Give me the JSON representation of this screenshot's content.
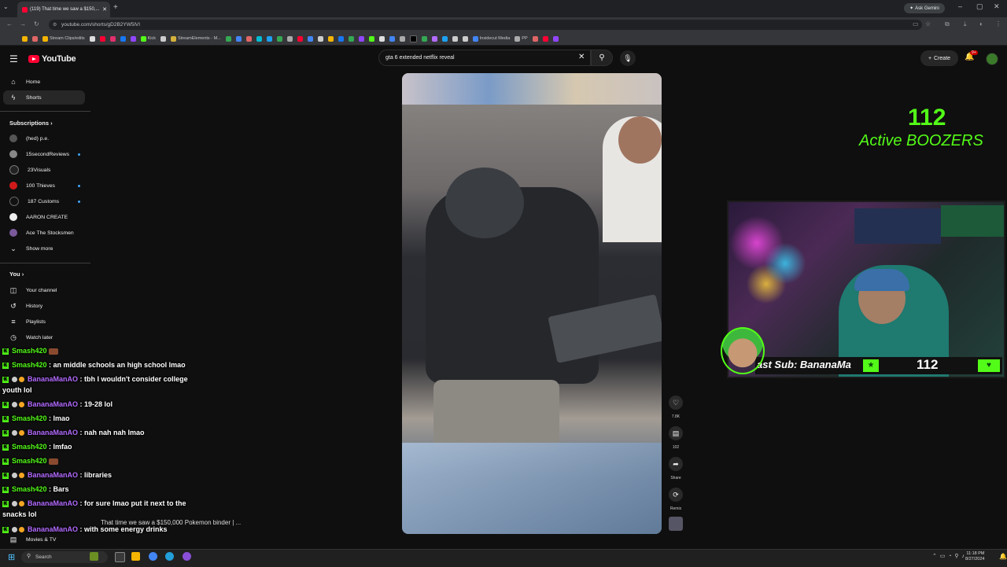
{
  "browser": {
    "tab_title": "(119) That time we saw a $150,...",
    "url": "youtube.com/shorts/gD2B2YW5lVI",
    "ask_gemini": "Ask Gemini",
    "bookmarks": [
      "Stream Clips/edits",
      "Kick",
      "StreamElements - M...",
      "Insidecut Media",
      "PP"
    ]
  },
  "youtube": {
    "logo": "YouTube",
    "search_value": "gta 6 extended netflix reveal",
    "create_label": "Create",
    "notif_badge": "9+",
    "sidebar": {
      "home": "Home",
      "shorts": "Shorts",
      "subscriptions_heading": "Subscriptions",
      "subscriptions": [
        "(hed) p.e.",
        "15secondReviews",
        "23Visuals",
        "100 Thieves",
        "187 Customs",
        "AARON CREATE",
        "Ace The Stocksmen"
      ],
      "show_more": "Show more",
      "you_heading": "You",
      "you_items": [
        "Your channel",
        "History",
        "Playlists",
        "Watch later"
      ],
      "bottom_item": "Movies & TV"
    },
    "video_title": "That time we saw a $150,000 Pokemon binder | ...",
    "actions": {
      "likes": "7.8K",
      "comments": "102",
      "share": "Share",
      "remix": "Remix"
    }
  },
  "stream": {
    "viewers_number": "112",
    "viewers_label": "Active BOOZERS",
    "last_sub_text": "ast Sub: BananaMa",
    "sub_counter": "112"
  },
  "chat": [
    {
      "user": "Smash420",
      "type": "kick",
      "msg": ""
    },
    {
      "user": "Smash420",
      "type": "kick",
      "msg": ": an middle schools an high school lmao"
    },
    {
      "user": "BananaManAO",
      "type": "badge",
      "msg": ": tbh I wouldn't consider college",
      "cont": "youth lol"
    },
    {
      "user": "BananaManAO",
      "type": "badge",
      "msg": ": 19-28 lol"
    },
    {
      "user": "Smash420",
      "type": "kick",
      "msg": ": lmao"
    },
    {
      "user": "BananaManAO",
      "type": "badge",
      "msg": ": nah nah nah lmao"
    },
    {
      "user": "Smash420",
      "type": "kick",
      "msg": ": lmfao"
    },
    {
      "user": "Smash420",
      "type": "kick",
      "msg": ""
    },
    {
      "user": "BananaManAO",
      "type": "badge",
      "msg": ": libraries"
    },
    {
      "user": "Smash420",
      "type": "kick",
      "msg": ": Bars"
    },
    {
      "user": "BananaManAO",
      "type": "badge",
      "msg": ": for sure lmao put it next to the",
      "cont": "snacks lol"
    },
    {
      "user": "BananaManAO",
      "type": "badge",
      "msg": ": with some energy drinks"
    }
  ],
  "taskbar": {
    "search": "Search",
    "time": "11:18 PM",
    "date": "8/27/2024"
  },
  "colors": {
    "kick_green": "#53fc18",
    "yt_red": "#ff0033",
    "chat_purple": "#b36bff"
  }
}
